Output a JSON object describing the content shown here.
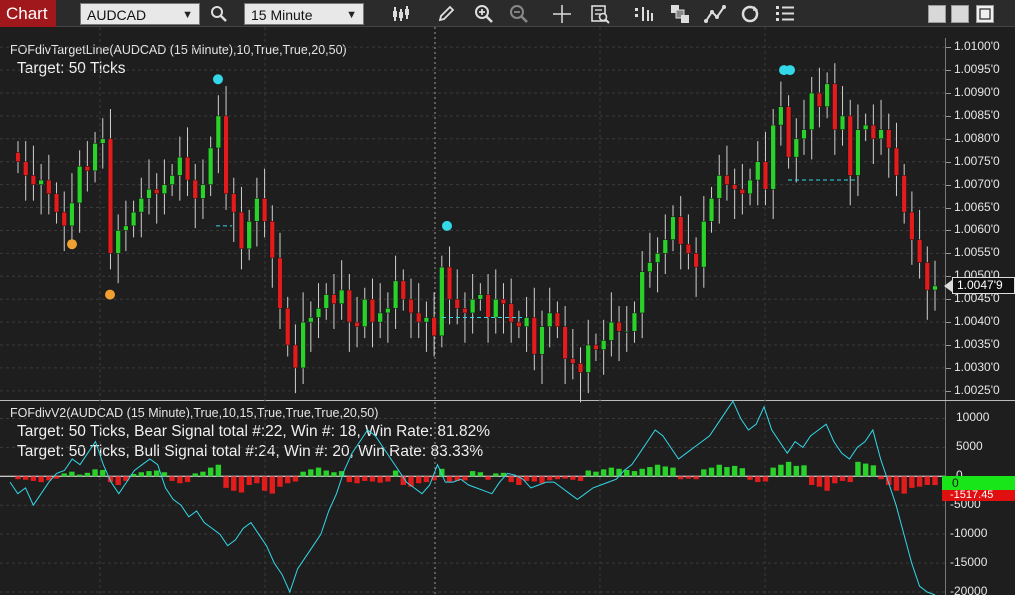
{
  "toolbar": {
    "app_title": "Chart",
    "instrument": "AUDCAD",
    "interval": "15 Minute",
    "icons": [
      "search-icon",
      "bar-type-icon",
      "pencil-icon",
      "zoom-in-icon",
      "zoom-out-icon",
      "crosshair-icon",
      "data-box-icon",
      "indicators-icon",
      "strategies-icon",
      "drawing-tools-icon",
      "refresh-icon",
      "properties-icon"
    ],
    "window_buttons": [
      "minimize",
      "maximize",
      "close"
    ]
  },
  "price_panel": {
    "title": "FOFdivTargetLine(AUDCAD (15 Minute),10,True,True,20,50)",
    "note": "Target: 50 Ticks",
    "axis_labels": [
      "1.0100'0",
      "1.0095'0",
      "1.0090'0",
      "1.0085'0",
      "1.0080'0",
      "1.0075'0",
      "1.0070'0",
      "1.0065'0",
      "1.0060'0",
      "1.0055'0",
      "1.0050'0",
      "1.0045'0",
      "1.0040'0",
      "1.0035'0",
      "1.0030'0",
      "1.0025'0"
    ],
    "last_price": "1.0047'9"
  },
  "osc_panel": {
    "title": "FOFdivV2(AUDCAD (15 Minute),True,10,15,True,True,True,20,50)",
    "bear_note": "Target: 50 Ticks, Bear Signal total #:22, Win #: 18, Win Rate: 81.82%",
    "bull_note": "Target: 50 Ticks, Bull Signal total #:24, Win #: 20, Win Rate: 83.33%",
    "axis_labels": [
      "10000",
      "5000",
      "0",
      "-5000",
      "-10000",
      "-15000",
      "-20000"
    ],
    "zero_value": "0",
    "line_value": "-1517.45"
  },
  "colors": {
    "up": "#2ad12a",
    "down": "#e21c1c",
    "wick": "#cfcfcf",
    "cyan": "#32d8e8",
    "orange": "#f0a030",
    "grid": "#3a3a3a"
  },
  "chart_data": [
    {
      "type": "candlestick",
      "instrument": "AUDCAD",
      "interval": "15 Minute",
      "ylim": [
        1.0023,
        1.0102
      ],
      "last_price": 1.00479,
      "closes": [
        1.0075,
        1.0072,
        1.007,
        1.0071,
        1.0068,
        1.0064,
        1.0061,
        1.0066,
        1.0074,
        1.0073,
        1.0079,
        1.008,
        1.0055,
        1.006,
        1.0061,
        1.0064,
        1.0067,
        1.0069,
        1.0068,
        1.007,
        1.0072,
        1.0076,
        1.0071,
        1.0067,
        1.007,
        1.0078,
        1.0085,
        1.0068,
        1.0064,
        1.0056,
        1.0062,
        1.0067,
        1.0062,
        1.0054,
        1.0043,
        1.0035,
        1.003,
        1.004,
        1.0041,
        1.0043,
        1.0046,
        1.0044,
        1.0047,
        1.004,
        1.0039,
        1.0045,
        1.004,
        1.0042,
        1.0043,
        1.0049,
        1.0045,
        1.0042,
        1.004,
        1.0041,
        1.0037,
        1.0052,
        1.0045,
        1.0043,
        1.0042,
        1.0045,
        1.0046,
        1.0041,
        1.0045,
        1.0044,
        1.004,
        1.0039,
        1.0041,
        1.0033,
        1.0039,
        1.0042,
        1.0039,
        1.0032,
        1.0031,
        1.0029,
        1.0035,
        1.0034,
        1.0036,
        1.004,
        1.0038,
        1.0038,
        1.0042,
        1.0051,
        1.0053,
        1.0055,
        1.0058,
        1.0063,
        1.0057,
        1.0055,
        1.0052,
        1.0062,
        1.0067,
        1.0072,
        1.007,
        1.0069,
        1.0068,
        1.0071,
        1.0075,
        1.0069,
        1.0083,
        1.0087,
        1.0076,
        1.008,
        1.0082,
        1.009,
        1.0087,
        1.0092,
        1.0082,
        1.0085,
        1.0072,
        1.0082,
        1.0083,
        1.008,
        1.0082,
        1.0078,
        1.0072,
        1.0064,
        1.0058,
        1.0053,
        1.0047,
        1.00479
      ],
      "annotations": [
        {
          "kind": "cyan-dot",
          "price": 1.0093
        },
        {
          "kind": "cyan-dot",
          "price": 1.0061
        },
        {
          "kind": "cyan-dot",
          "price": 1.0095
        },
        {
          "kind": "cyan-dot",
          "price": 1.0095
        },
        {
          "kind": "orange-dot",
          "price": 1.0057
        },
        {
          "kind": "orange-dot",
          "price": 1.0046
        },
        {
          "kind": "target-line",
          "price": 1.0041
        },
        {
          "kind": "target-line",
          "price": 1.0071
        },
        {
          "kind": "target-line",
          "price": 1.0061
        }
      ]
    },
    {
      "type": "bar",
      "series": [
        {
          "name": "histogram",
          "values": [
            -500,
            -600,
            -800,
            -1000,
            -700,
            -400,
            500,
            800,
            300,
            600,
            1200,
            1100,
            -1000,
            -1500,
            -800,
            400,
            700,
            900,
            1000,
            700,
            -800,
            -1200,
            -1000,
            500,
            800,
            1500,
            2000,
            -2000,
            -2500,
            -2800,
            -1500,
            -1200,
            -2500,
            -3000,
            -1800,
            -1200,
            -900,
            800,
            1200,
            1500,
            1000,
            700,
            900,
            -1000,
            -1200,
            -800,
            -900,
            -1100,
            -900,
            1000,
            -1500,
            -1800,
            -1200,
            -1000,
            -700,
            1300,
            -1000,
            -800,
            -700,
            900,
            700,
            -600,
            500,
            600,
            -1000,
            -1500,
            -800,
            -900,
            -1200,
            -700,
            -500,
            -400,
            -600,
            -800,
            1000,
            800,
            1200,
            1500,
            1300,
            1100,
            900,
            1300,
            1600,
            2000,
            1700,
            1500,
            -500,
            -400,
            -500,
            1200,
            1500,
            2000,
            1600,
            1800,
            1400,
            -600,
            -1000,
            -900,
            1500,
            2000,
            2500,
            1800,
            1900,
            -1500,
            -1800,
            -2500,
            -1200,
            -800,
            -1000,
            2500,
            2200,
            1900,
            -500,
            -1500,
            -2500,
            -3000,
            -2000,
            -1800,
            -1500,
            -1517
          ]
        },
        {
          "name": "line",
          "values": [
            -1000,
            -3000,
            -2000,
            -5000,
            -3000,
            -1000,
            500,
            1000,
            3000,
            2000,
            4000,
            6000,
            2000,
            -1000,
            -3000,
            -1000,
            1000,
            2000,
            3000,
            2000,
            -2000,
            -4000,
            -5000,
            -7000,
            -6000,
            -8000,
            -9000,
            -10000,
            -12000,
            -11000,
            -9000,
            -8000,
            -10000,
            -12000,
            -15000,
            -17000,
            -20000,
            -16000,
            -14000,
            -12000,
            -10000,
            -6000,
            -3000,
            1000,
            4000,
            6000,
            8000,
            7000,
            5000,
            3000,
            1000,
            -1000,
            -2000,
            -3000,
            -1500,
            2000,
            -1000,
            -1000,
            -500,
            -1500,
            -2000,
            -2500,
            -3000,
            -1000,
            500,
            200,
            -500,
            -2000,
            -1500,
            -1000,
            -1000,
            -2000,
            -3000,
            -4000,
            -3000,
            -2000,
            -1500,
            -1000,
            -500,
            1000,
            2000,
            4000,
            6000,
            8000,
            7000,
            5000,
            3000,
            4000,
            5000,
            6000,
            7000,
            9000,
            11000,
            13000,
            10000,
            8000,
            9000,
            12000,
            8000,
            6000,
            4000,
            6000,
            5000,
            7000,
            8000,
            9000,
            6000,
            4000,
            3000,
            5000,
            6000,
            8000,
            3000,
            -1000,
            -5000,
            -10000,
            -15000,
            -19000,
            -20000,
            -20500
          ]
        }
      ],
      "ylim": [
        -20000,
        12500
      ],
      "zero_value": 0,
      "last_line_value": -1517.45
    }
  ]
}
